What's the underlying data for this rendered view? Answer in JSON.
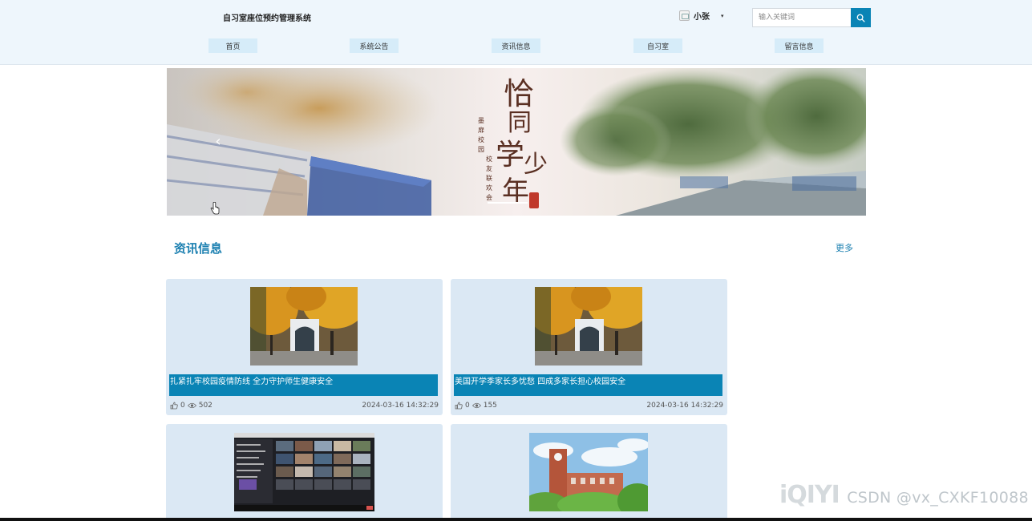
{
  "header": {
    "site_title": "自习室座位预约管理系统",
    "username": "小张",
    "caret": "▾",
    "search_placeholder": "输入关键词"
  },
  "nav": {
    "items": [
      {
        "label": "首页"
      },
      {
        "label": "系统公告"
      },
      {
        "label": "资讯信息"
      },
      {
        "label": "自习室"
      },
      {
        "label": "留言信息"
      }
    ]
  },
  "banner": {
    "calligraphy_title": "恰同学少年",
    "calligraphy_sub": "墨扉校园校友联欢会",
    "prev_glyph": "‹"
  },
  "section": {
    "title": "资讯信息",
    "more": "更多"
  },
  "cards": [
    {
      "caption": "扎紧扎牢校园疫情防线 全力守护师生健康安全",
      "likes": "0",
      "views": "502",
      "date": "2024-03-16 14:32:29"
    },
    {
      "caption": "美国开学季家长多忧愁 四成多家长担心校园安全",
      "likes": "0",
      "views": "155",
      "date": "2024-03-16 14:32:29"
    },
    {
      "caption": "",
      "likes": "",
      "views": "",
      "date": ""
    },
    {
      "caption": "",
      "likes": "",
      "views": "",
      "date": ""
    }
  ],
  "watermark": {
    "logo": "iQIYI",
    "text": "CSDN @vx_CXKF10088"
  },
  "colors": {
    "accent": "#0a84b5",
    "header_bg": "#eef6fc",
    "nav_item_bg": "#d6ecf9",
    "card_bg": "#dbe8f4"
  }
}
